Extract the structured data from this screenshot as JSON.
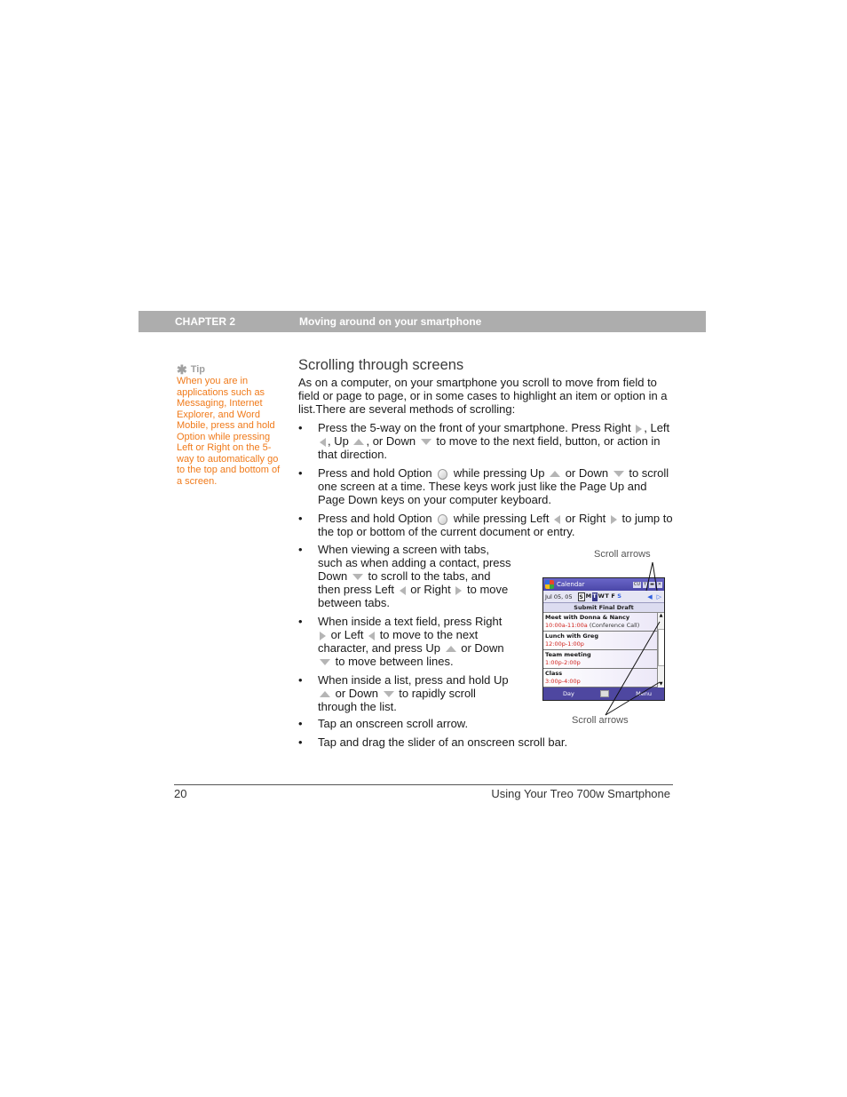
{
  "header": {
    "chapter": "CHAPTER 2",
    "chapter_title": "Moving around on your smartphone"
  },
  "tip": {
    "label": "Tip",
    "icon": "asterisk-icon",
    "text": "When you are in applications such as Messaging, Internet Explorer, and Word Mobile, press and hold Option while pressing Left or Right on the 5-way to automatically go to the top and bottom of a screen."
  },
  "section": {
    "title": "Scrolling through screens",
    "intro": "As on a computer, on your smartphone you scroll to move from field to field or page to page, or in some cases to highlight an item or option in a list.There are several methods of scrolling:"
  },
  "bullets": {
    "b1": {
      "t1": "Press the 5-way on the front of your smartphone. Press Right ",
      "t2": ", Left ",
      "t3": ", Up ",
      "t4": ", or Down ",
      "t5": " to move to the next field, button, or action in that direction."
    },
    "b2": {
      "t1": "Press and hold Option ",
      "t2": " while pressing Up ",
      "t3": " or Down ",
      "t4": " to scroll one screen at a time. These keys work just like the Page Up and Page Down keys on your computer keyboard."
    },
    "b3": {
      "t1": "Press and hold Option ",
      "t2": " while pressing Left ",
      "t3": " or Right ",
      "t4": " to jump to the top or bottom of the current document or entry."
    },
    "b4": {
      "t1": "When viewing a screen with tabs, such as when adding a contact, press Down ",
      "t2": " to scroll to the tabs, and then press Left ",
      "t3": " or Right ",
      "t4": " to move between tabs."
    },
    "b5": {
      "t1": "When inside a text field, press Right ",
      "t2": " or Left ",
      "t3": " to move to the next character, and press Up ",
      "t4": " or Down ",
      "t5": " to move between lines."
    },
    "b6": {
      "t1": "When inside a list, press and hold Up ",
      "t2": " or Down ",
      "t3": " to rapidly scroll through the list."
    },
    "b7": "Tap an onscreen scroll arrow.",
    "b8": "Tap and drag the slider of an onscreen scroll bar.",
    "bullet_char": "•"
  },
  "phone": {
    "app_title": "Calendar",
    "date": "Jul 05, 05",
    "days": [
      "S",
      "M",
      "T",
      "W",
      "T",
      "F",
      "S"
    ],
    "all_day_event": "Submit Final Draft",
    "appointments": [
      {
        "name": "Meet with Donna & Nancy",
        "time": "10:00a-11:00a",
        "location": "(Conference Call)"
      },
      {
        "name": "Lunch with Greg",
        "time": "12:00p-1:00p",
        "location": ""
      },
      {
        "name": "Team meeting",
        "time": "1:00p-2:00p",
        "location": ""
      },
      {
        "name": "Class",
        "time": "3:00p-4:00p",
        "location": ""
      }
    ],
    "softkey_left": "Day",
    "softkey_right": "Menu",
    "nav_left": "◀",
    "nav_right": "▷",
    "scroll_up": "▲",
    "scroll_down": "▼",
    "status": [
      "CU",
      "Y",
      "▬",
      "✕"
    ]
  },
  "callouts": {
    "top": "Scroll arrows",
    "bottom": "Scroll arrows"
  },
  "footer": {
    "page_number": "20",
    "book_title": "Using Your Treo 700w Smartphone"
  },
  "colors": {
    "chapter_bar": "#adadad",
    "tip_text": "#f07a1a",
    "appointment_time": "#d0201a",
    "phone_titlebar": "#4b47a8"
  }
}
